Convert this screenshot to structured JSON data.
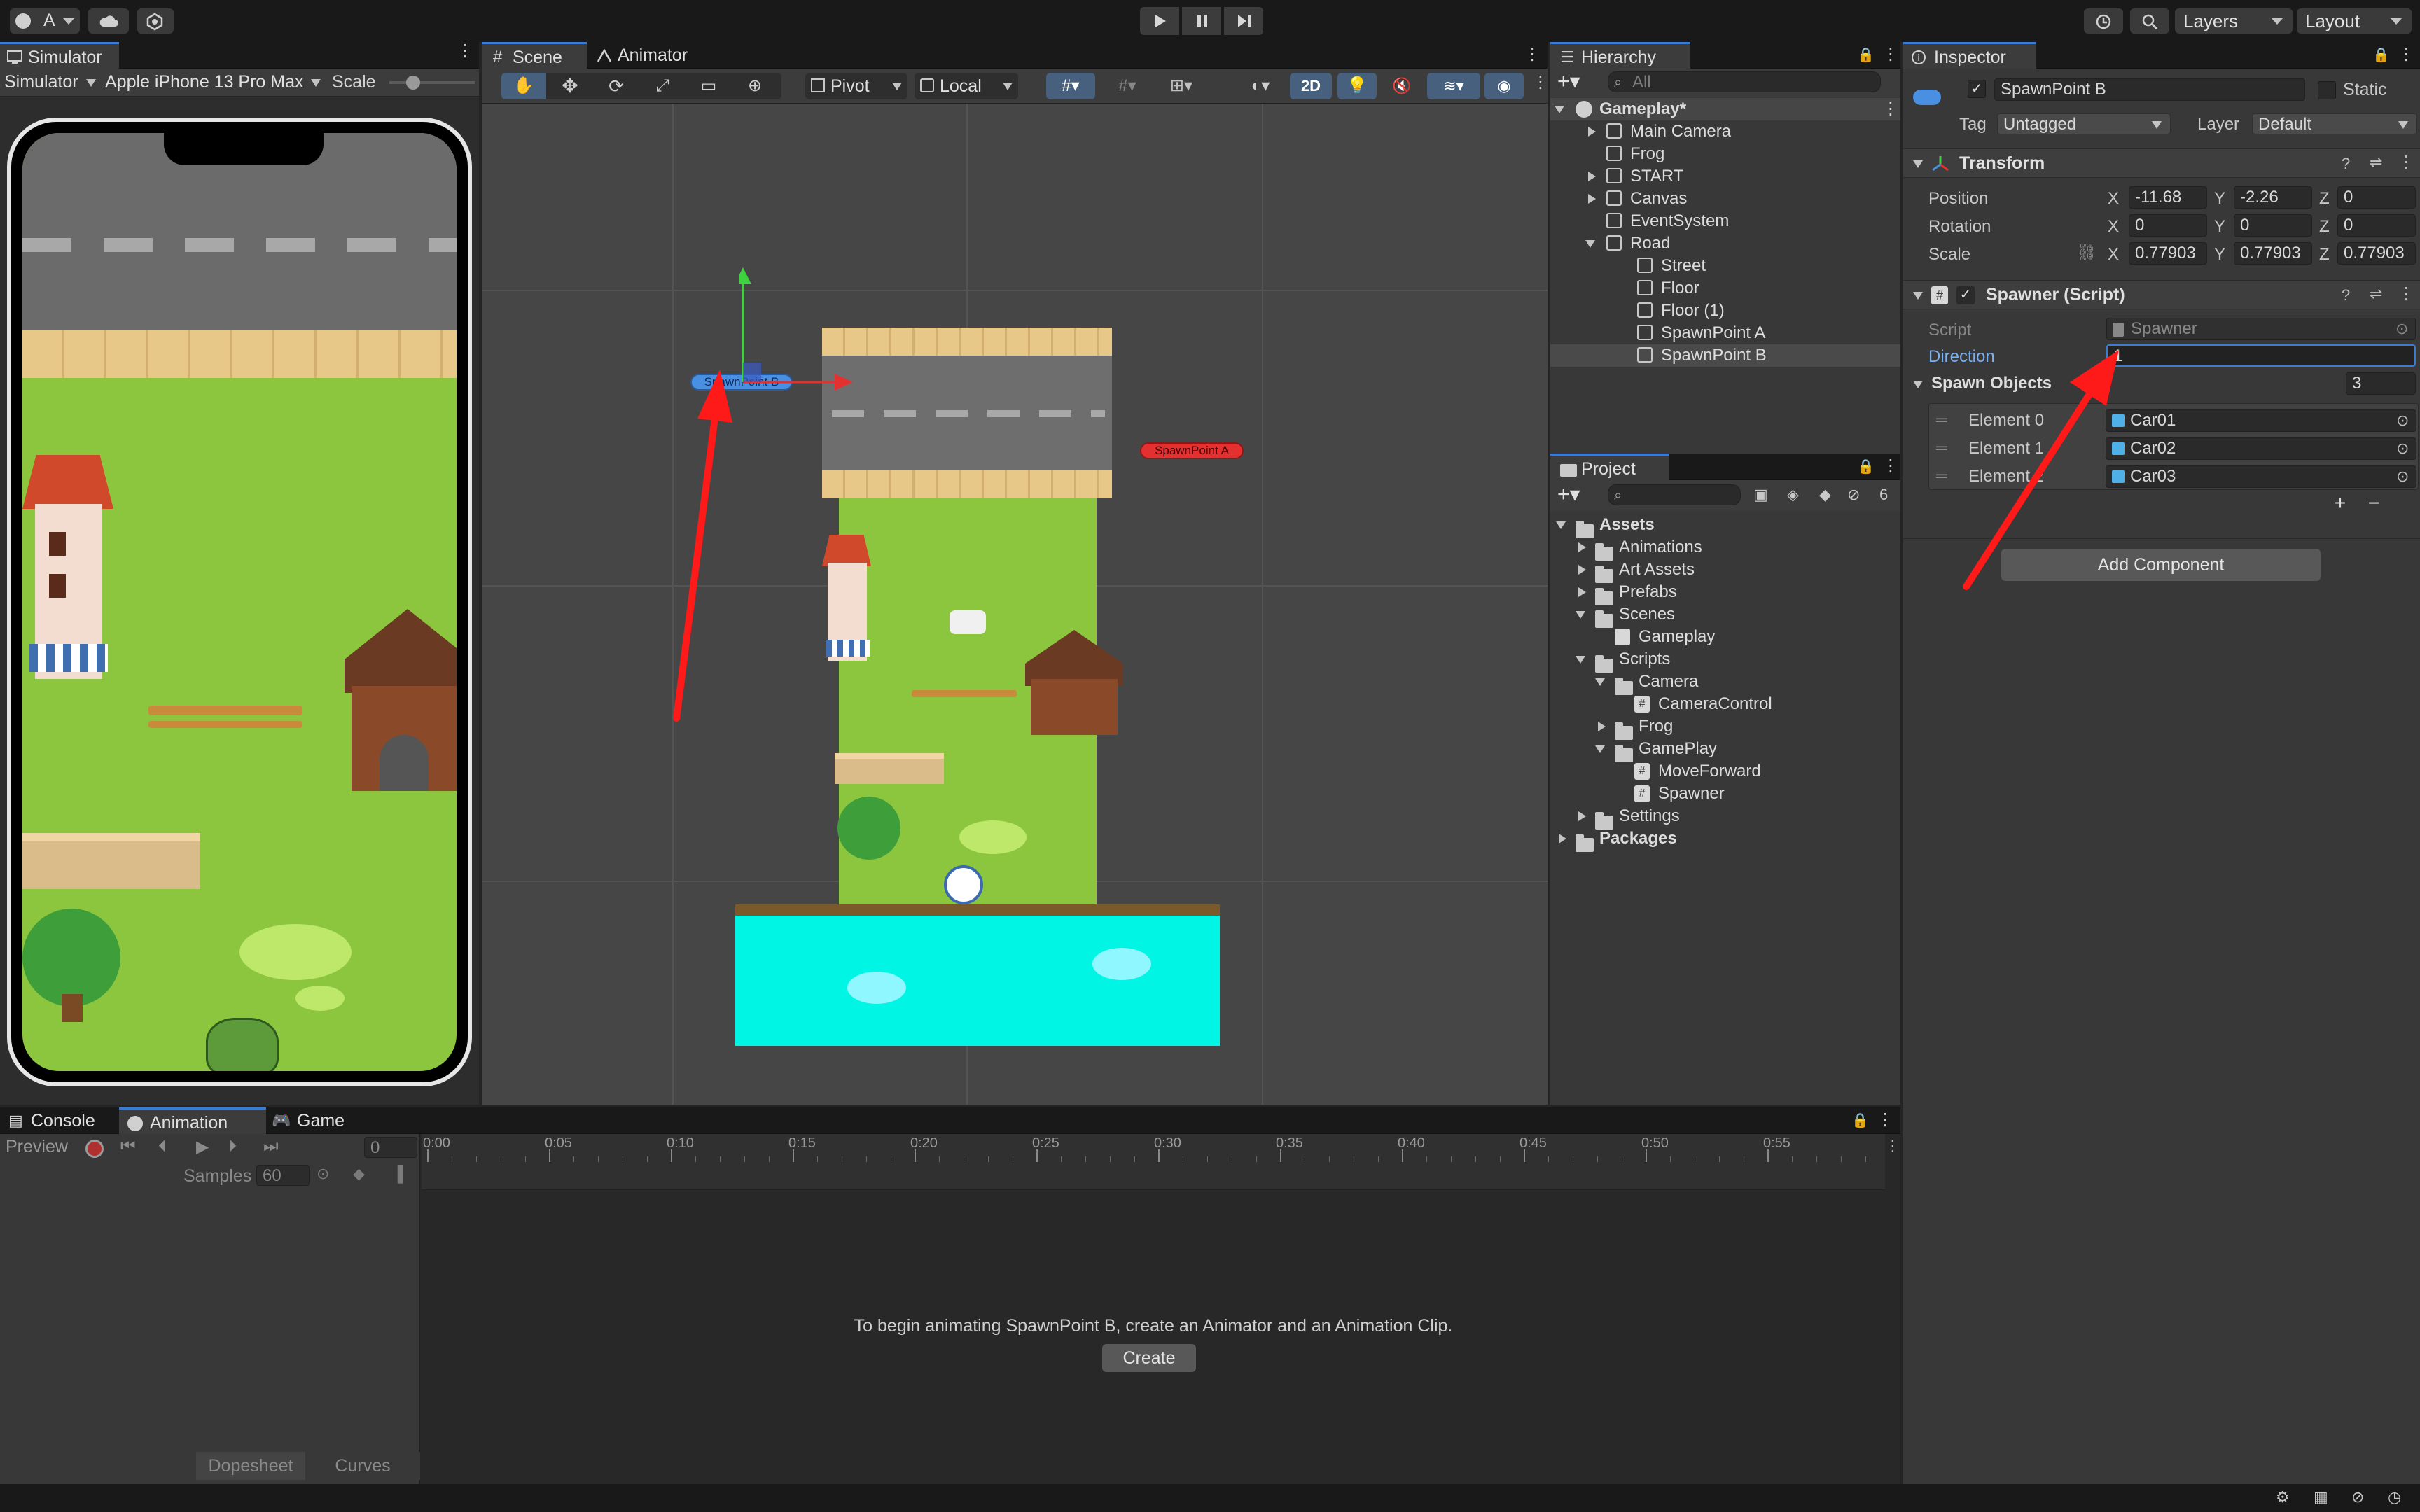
{
  "toolbar": {
    "account_label": "A",
    "layers_label": "Layers",
    "layout_label": "Layout"
  },
  "simulator": {
    "tab_label": "Simulator",
    "mode_dropdown": "Simulator",
    "device_dropdown": "Apple iPhone 13 Pro Max",
    "scale_label": "Scale"
  },
  "scene": {
    "tabs": [
      "Scene",
      "Animator"
    ],
    "pivot_label": "Pivot",
    "local_label": "Local",
    "mode_2d": "2D",
    "spawn_a_label": "SpawnPoint A",
    "spawn_b_label": "SpawnPoint B"
  },
  "hierarchy": {
    "tab_label": "Hierarchy",
    "search_placeholder": "All",
    "items": [
      {
        "label": "Gameplay*",
        "depth": 0,
        "expanded": true,
        "type": "scene"
      },
      {
        "label": "Main Camera",
        "depth": 1,
        "arrow": "right"
      },
      {
        "label": "Frog",
        "depth": 1,
        "arrow": "none"
      },
      {
        "label": "START",
        "depth": 1,
        "arrow": "right"
      },
      {
        "label": "Canvas",
        "depth": 1,
        "arrow": "right"
      },
      {
        "label": "EventSystem",
        "depth": 1,
        "arrow": "none"
      },
      {
        "label": "Road",
        "depth": 1,
        "arrow": "down"
      },
      {
        "label": "Street",
        "depth": 2,
        "arrow": "none"
      },
      {
        "label": "Floor",
        "depth": 2,
        "arrow": "none"
      },
      {
        "label": "Floor (1)",
        "depth": 2,
        "arrow": "none"
      },
      {
        "label": "SpawnPoint A",
        "depth": 2,
        "arrow": "none"
      },
      {
        "label": "SpawnPoint B",
        "depth": 2,
        "arrow": "none",
        "selected": true
      }
    ]
  },
  "project": {
    "tab_label": "Project",
    "hidden_count": "6",
    "items": [
      {
        "label": "Assets",
        "depth": 0,
        "arrow": "down",
        "bold": true
      },
      {
        "label": "Animations",
        "depth": 1,
        "arrow": "right"
      },
      {
        "label": "Art Assets",
        "depth": 1,
        "arrow": "right"
      },
      {
        "label": "Prefabs",
        "depth": 1,
        "arrow": "right"
      },
      {
        "label": "Scenes",
        "depth": 1,
        "arrow": "down"
      },
      {
        "label": "Gameplay",
        "depth": 2,
        "arrow": "none",
        "kind": "scene"
      },
      {
        "label": "Scripts",
        "depth": 1,
        "arrow": "down"
      },
      {
        "label": "Camera",
        "depth": 2,
        "arrow": "down"
      },
      {
        "label": "CameraControl",
        "depth": 3,
        "arrow": "none",
        "kind": "script"
      },
      {
        "label": "Frog",
        "depth": 2,
        "arrow": "right"
      },
      {
        "label": "GamePlay",
        "depth": 2,
        "arrow": "down"
      },
      {
        "label": "MoveForward",
        "depth": 3,
        "arrow": "none",
        "kind": "script"
      },
      {
        "label": "Spawner",
        "depth": 3,
        "arrow": "none",
        "kind": "script"
      },
      {
        "label": "Settings",
        "depth": 1,
        "arrow": "right"
      },
      {
        "label": "Packages",
        "depth": 0,
        "arrow": "right",
        "bold": true
      }
    ]
  },
  "inspector": {
    "tab_label": "Inspector",
    "object_name": "SpawnPoint B",
    "static_label": "Static",
    "tag_label": "Tag",
    "tag_value": "Untagged",
    "layer_label": "Layer",
    "layer_value": "Default",
    "transform": {
      "title": "Transform",
      "position_label": "Position",
      "rotation_label": "Rotation",
      "scale_label": "Scale",
      "position": {
        "x": "-11.68",
        "y": "-2.26",
        "z": "0"
      },
      "rotation": {
        "x": "0",
        "y": "0",
        "z": "0"
      },
      "scale": {
        "x": "0.77903",
        "y": "0.77903",
        "z": "0.77903"
      }
    },
    "spawner": {
      "title": "Spawner (Script)",
      "script_label": "Script",
      "script_value": "Spawner",
      "direction_label": "Direction",
      "direction_value": "1",
      "spawn_objects_label": "Spawn Objects",
      "spawn_objects_count": "3",
      "elements": [
        {
          "label": "Element 0",
          "value": "Car01"
        },
        {
          "label": "Element 1",
          "value": "Car02"
        },
        {
          "label": "Element 2",
          "value": "Car03"
        }
      ]
    },
    "add_component_label": "Add Component"
  },
  "animation": {
    "tabs": [
      "Console",
      "Animation",
      "Game"
    ],
    "preview_label": "Preview",
    "frame_value": "0",
    "samples_label": "Samples",
    "samples_value": "60",
    "timeline_ticks": [
      "0:00",
      "0:05",
      "0:10",
      "0:15",
      "0:20",
      "0:25",
      "0:30",
      "0:35",
      "0:40",
      "0:45",
      "0:50",
      "0:55"
    ],
    "message": "To begin animating SpawnPoint B, create an Animator and an Animation Clip.",
    "create_label": "Create",
    "dopesheet_label": "Dopesheet",
    "curves_label": "Curves"
  },
  "colors": {
    "accent_blue": "#3a7bd5",
    "annotation_red": "#ff1a1a",
    "grass": "#8cc63f",
    "water": "#00f5e4"
  }
}
